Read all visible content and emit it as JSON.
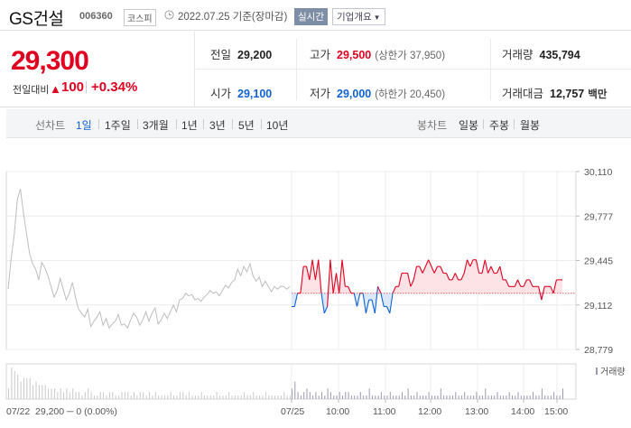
{
  "header": {
    "name": "GS건설",
    "code": "006360",
    "market": "코스피",
    "date": "2022.07.25 기준(장마감)",
    "realtime": "실시간",
    "profile": "기업개요"
  },
  "price": {
    "current": "29,300",
    "change_label": "전일대비",
    "change_arrow": "▲",
    "change": "100",
    "change_pct": "+0.34%"
  },
  "stats": {
    "prev_close": {
      "label": "전일",
      "value": "29,200"
    },
    "high": {
      "label": "고가",
      "value": "29,500",
      "sub": "(상한가 37,950)"
    },
    "volume": {
      "label": "거래량",
      "value": "435,794"
    },
    "open": {
      "label": "시가",
      "value": "29,100"
    },
    "low": {
      "label": "저가",
      "value": "29,000",
      "sub": "(하한가 20,450)"
    },
    "amount": {
      "label": "거래대금",
      "value": "12,757",
      "unit": "백만"
    }
  },
  "tabs": {
    "line_label": "선차트",
    "line_periods": [
      "1일",
      "1주일",
      "3개월",
      "1년",
      "3년",
      "5년",
      "10년"
    ],
    "candle_label": "봉차트",
    "candle_periods": [
      "일봉",
      "주봉",
      "월봉"
    ]
  },
  "chart_data": {
    "type": "line",
    "y_ticks": [
      "30,110",
      "29,777",
      "29,445",
      "29,112",
      "28,779"
    ],
    "ylim": [
      28779,
      30110
    ],
    "prev_close": 29200,
    "prev_day_label": "07/22",
    "prev_day_summary": "29,200 ─ 0 (0.00%)",
    "x_labels": [
      "07/25",
      "10:00",
      "11:00",
      "12:00",
      "13:00",
      "14:00",
      "15:00"
    ],
    "volume_legend": "거래량",
    "colors": {
      "up": "#e0001f",
      "down": "#1162d4",
      "prev": "#bdbdbd",
      "up_fill": "#fde3e6",
      "down_fill": "#dbe8fa",
      "volume": "#9a9ab0"
    },
    "prev_day_series": [
      29230,
      29460,
      29640,
      29900,
      29980,
      29800,
      29650,
      29500,
      29420,
      29380,
      29300,
      29430,
      29390,
      29330,
      29250,
      29170,
      29220,
      29310,
      29230,
      29150,
      29200,
      29280,
      29170,
      29080,
      29050,
      29020,
      29080,
      28950,
      28990,
      29020,
      29060,
      28960,
      29010,
      28940,
      28970,
      28990,
      29040,
      28960,
      28970,
      28940,
      29000,
      29050,
      29020,
      28960,
      29000,
      29060,
      28990,
      29050,
      29090,
      28970,
      29000,
      29050,
      29010,
      29060,
      29110,
      29060,
      29150,
      29160,
      29200,
      29180,
      29190,
      29150,
      29160,
      29140,
      29170,
      29190,
      29220,
      29200,
      29210,
      29180,
      29220,
      29260,
      29240,
      29280,
      29300,
      29380,
      29330,
      29400,
      29360,
      29420,
      29330,
      29290,
      29320,
      29250,
      29290,
      29250,
      29210,
      29250,
      29230,
      29250,
      29250,
      29230,
      29250
    ],
    "today_series": [
      29100,
      29100,
      29200,
      29200,
      29400,
      29400,
      29300,
      29450,
      29300,
      29450,
      29200,
      29050,
      29100,
      29450,
      29200,
      29350,
      29200,
      29450,
      29250,
      29250,
      29200,
      29200,
      29100,
      29200,
      29200,
      29050,
      29150,
      29150,
      29050,
      29250,
      29200,
      29100,
      29100,
      29050,
      29200,
      29250,
      29250,
      29350,
      29350,
      29350,
      29250,
      29300,
      29400,
      29400,
      29350,
      29400,
      29450,
      29400,
      29350,
      29400,
      29400,
      29350,
      29350,
      29300,
      29300,
      29350,
      29300,
      29300,
      29350,
      29450,
      29400,
      29450,
      29450,
      29350,
      29350,
      29450,
      29350,
      29400,
      29350,
      29350,
      29400,
      29300,
      29300,
      29250,
      29250,
      29250,
      29300,
      29250,
      29250,
      29300,
      29300,
      29250,
      29250,
      29250,
      29150,
      29250,
      29250,
      29250,
      29200,
      29300,
      29300,
      29300
    ],
    "prev_day_volume": [
      3,
      9,
      8,
      7,
      5,
      6,
      6,
      6,
      4,
      5,
      4,
      4,
      4,
      3,
      3,
      3,
      2,
      3,
      2,
      3,
      2,
      3,
      2,
      2,
      1,
      2,
      3,
      2,
      1,
      1,
      2,
      2,
      1,
      2,
      2,
      1,
      1,
      2,
      2,
      2,
      1,
      2,
      1,
      2,
      2,
      1,
      2,
      1,
      2,
      1,
      1,
      1,
      1,
      2,
      1,
      1,
      2,
      2,
      1,
      2,
      1,
      1,
      1,
      2,
      1,
      1,
      1,
      1,
      2,
      1,
      1,
      1,
      2,
      1,
      1,
      1,
      1,
      2,
      1,
      1,
      2,
      1,
      1,
      1,
      2,
      1,
      1,
      1,
      1,
      1,
      2,
      1,
      1
    ],
    "today_volume": [
      3,
      5,
      2,
      1,
      2,
      3,
      2,
      1,
      2,
      1,
      2,
      1,
      3,
      2,
      1,
      1,
      2,
      1,
      2,
      2,
      1,
      1,
      1,
      2,
      1,
      1,
      3,
      1,
      1,
      1,
      2,
      1,
      1,
      2,
      1,
      1,
      1,
      2,
      1,
      3,
      1,
      1,
      2,
      1,
      1,
      1,
      2,
      1,
      1,
      1,
      3,
      1,
      1,
      1,
      1,
      2,
      1,
      1,
      2,
      1,
      1,
      1,
      2,
      1,
      1,
      3,
      1,
      1,
      1,
      2,
      1,
      1,
      1,
      2,
      1,
      1,
      2,
      1,
      1,
      1,
      1,
      2,
      1,
      1,
      3,
      1,
      1,
      1,
      2,
      1,
      1,
      3
    ]
  }
}
